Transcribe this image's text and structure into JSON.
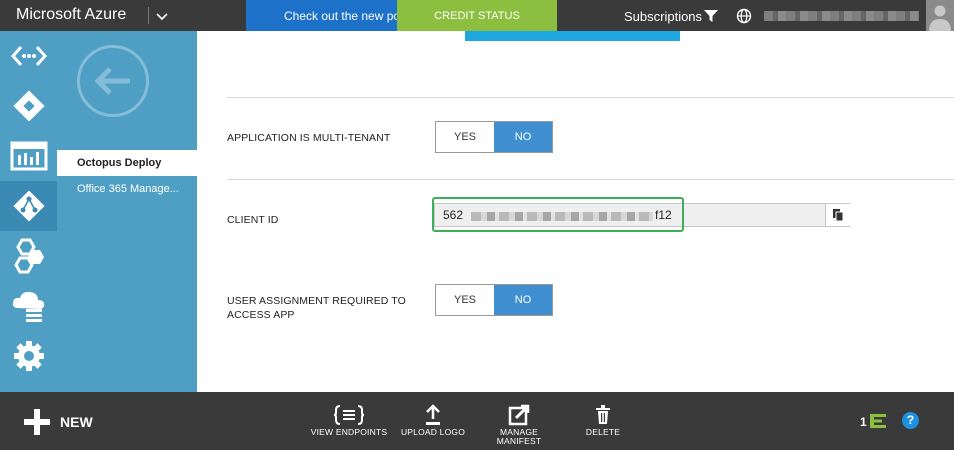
{
  "header": {
    "brand": "Microsoft Azure",
    "promo_text": "Check out the new port",
    "credit_status": "CREDIT STATUS",
    "subscriptions": "Subscriptions"
  },
  "left_nav": {
    "icons": [
      "code-icon",
      "apps-icon",
      "dashboard-icon",
      "active-directory-icon",
      "hex-services-icon",
      "cloud-service-icon",
      "settings-icon"
    ],
    "active_index": 3
  },
  "sub_nav": {
    "items": [
      {
        "label": "Octopus Deploy",
        "active": true
      },
      {
        "label": "Office 365 Manage...",
        "active": false
      }
    ]
  },
  "form": {
    "multi_tenant": {
      "label": "APPLICATION IS MULTI-TENANT",
      "yes": "YES",
      "no": "NO",
      "selected": "NO"
    },
    "client_id": {
      "label": "CLIENT ID",
      "value_start": "562",
      "value_end": "f12"
    },
    "user_assignment": {
      "label": "USER ASSIGNMENT REQUIRED TO ACCESS APP",
      "yes": "YES",
      "no": "NO",
      "selected": "NO"
    }
  },
  "command_bar": {
    "new_label": "NEW",
    "commands": [
      "VIEW ENDPOINTS",
      "UPLOAD LOGO",
      "MANAGE MANIFEST",
      "DELETE"
    ],
    "count": "1"
  },
  "colors": {
    "accent": "#1ea7e1",
    "nav_blue": "#4f9fc4",
    "toggle_on": "#3f8fd1",
    "credit_green": "#8cbf3f",
    "highlight_green": "#3fae5a"
  }
}
